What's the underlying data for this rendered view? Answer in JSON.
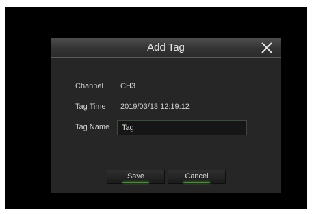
{
  "dialog": {
    "title": "Add Tag",
    "close_icon": "close-icon"
  },
  "fields": {
    "channel_label": "Channel",
    "channel_value": "CH3",
    "tag_time_label": "Tag Time",
    "tag_time_value": "2019/03/13 12:19:12",
    "tag_name_label": "Tag Name",
    "tag_name_value": "Tag"
  },
  "buttons": {
    "save_label": "Save",
    "cancel_label": "Cancel"
  },
  "colors": {
    "accent_glow": "#4a8a3a",
    "background": "#262626"
  }
}
